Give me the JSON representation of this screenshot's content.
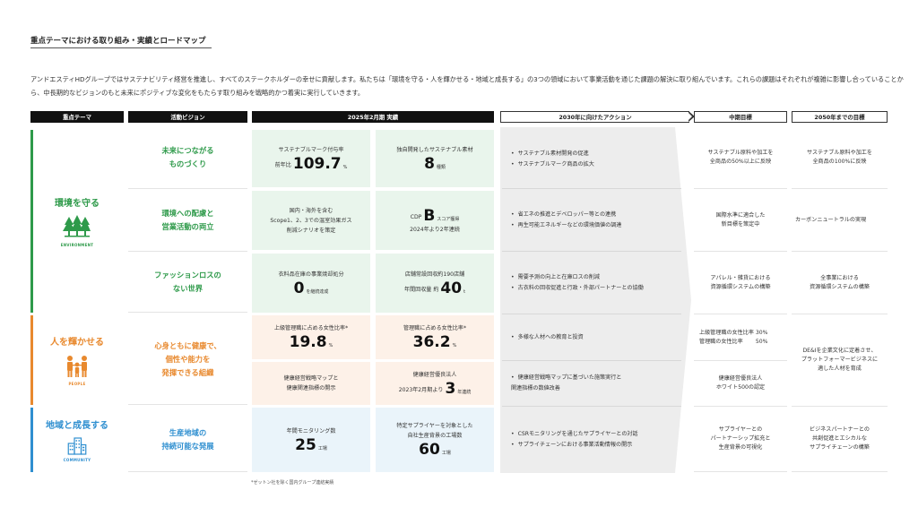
{
  "title": "重点テーマにおける取り組み・実績とロードマップ",
  "intro": "アンドエスティHDグループではサステナビリティ経営を推進し、すべてのステークホルダーの幸せに貢献します。私たちは「環境を守る・人を輝かせる・地域と成長する」の3つの領域において事業活動を通じた課題の解決に取り組んでいます。これらの課題はそれぞれが複雑に影響し合っていることから、中長期的なビジョンのもと未来にポジティブな変化をもたらす取り組みを戦略的かつ着実に実行していきます。",
  "headers": {
    "theme": "重点テーマ",
    "vision": "活動ビジョン",
    "results": "2025年2月期 実績",
    "actions": "2030年に向けたアクション",
    "mid": "中期目標",
    "goal": "2050年までの目標"
  },
  "colors": {
    "green": "#2e9a4a",
    "orange": "#e8892e",
    "blue": "#2f8fd0"
  },
  "themes": [
    {
      "label": "環境を守る",
      "icon": "trees-icon",
      "caption": "ENVIRONMENT"
    },
    {
      "label": "人を輝かせる",
      "icon": "people-icon",
      "caption": "PEOPLE"
    },
    {
      "label": "地域と成長する",
      "icon": "buildings-icon",
      "caption": "COMMUNITY"
    }
  ],
  "visions": [
    "未来につながる\nものづくり",
    "環境への配慮と\n営業活動の両立",
    "ファッションロスの\nない世界",
    "心身ともに健康で、\n個性や能力を\n発揮できる組織",
    "生産地域の\n持続可能な発展"
  ],
  "results": {
    "r1a": {
      "label": "サステナブルマーク付与率",
      "prefix": "前年比",
      "value": "109.7",
      "unit": "%"
    },
    "r1b": {
      "label": "独自開発したサステナブル素材",
      "value": "8",
      "unit": "種類"
    },
    "r2a": {
      "text": "国内・海外を含む\nScope1、2、3での温室効果ガス\n削減シナリオを策定"
    },
    "r2b": {
      "prefix": "CDP",
      "value": "B",
      "suffix": "スコア獲得",
      "sub": "2024年より2年連続"
    },
    "r3a": {
      "label": "衣料品在庫の事業焼却処分",
      "value": "0",
      "unit": "を継続達成"
    },
    "r3b": {
      "label": "店舗常設回収約190店舗",
      "prefix": "年間回収量 約",
      "value": "40",
      "unit": "t"
    },
    "r4a": {
      "label": "上級管理職に占める女性比率*",
      "value": "19.8",
      "unit": "%"
    },
    "r4b": {
      "label": "管理職に占める女性比率*",
      "value": "36.2",
      "unit": "%"
    },
    "r5a": {
      "text": "健康経営戦略マップと\n健康関連指標の開示"
    },
    "r5b": {
      "label": "健康経営優良法人",
      "prefix": "2023年2月期より",
      "value": "3",
      "unit": "年連続"
    },
    "r6a": {
      "label": "年間モニタリング数",
      "value": "25",
      "unit": "工場"
    },
    "r6b": {
      "label": "特定サプライヤーを対象とした\n自社生産背景の工場数",
      "value": "60",
      "unit": "工場"
    }
  },
  "actions": [
    [
      "サステナブル素材開発の促進",
      "サステナブルマーク商品の拡大"
    ],
    [
      "省エネの推進とデベロッパー等との連携",
      "再生可能エネルギーなどの環境価値の調達"
    ],
    [
      "需要予測の向上と在庫ロスの削減",
      "古衣料の回収促進と行政・外部パートナーとの協働"
    ],
    [
      "多様な人材への教育と投資"
    ],
    [
      "健康経営戦略マップに基づいた施策実行と\n関連指標の数値改善"
    ],
    [
      "CSRモニタリングを通じたサプライヤーとの対話",
      "サプライチェーンにおける事業活動情報の開示"
    ]
  ],
  "mid_goals": [
    "サステナブル原料や加工を\n全商品の50%以上に反映",
    "国際水準に適合した\n新目標を策定中",
    "アパレル・雑貨における\n資源循環システムの構築",
    "上級管理職の女性比率 30%\n管理職の女性比率　　 50%",
    "健康経営優良法人\nホワイト500の認定",
    "サプライヤーとの\nパートナーシップ拡充と\n生産背景の可視化"
  ],
  "goals": [
    "サステナブル原料や加工を\n全商品の100%に反映",
    "カーボンニュートラルの実現",
    "全事業における\n資源循環システムの構築",
    "DE&Iを企業文化に定着させ、\nプラットフォーマービジネスに\n適した人材を育成",
    "ビジネスパートナーとの\n共創促進とエシカルな\nサプライチェーンの構築"
  ],
  "footnote": "*ゼットン社を除く国内グループ連結実績"
}
